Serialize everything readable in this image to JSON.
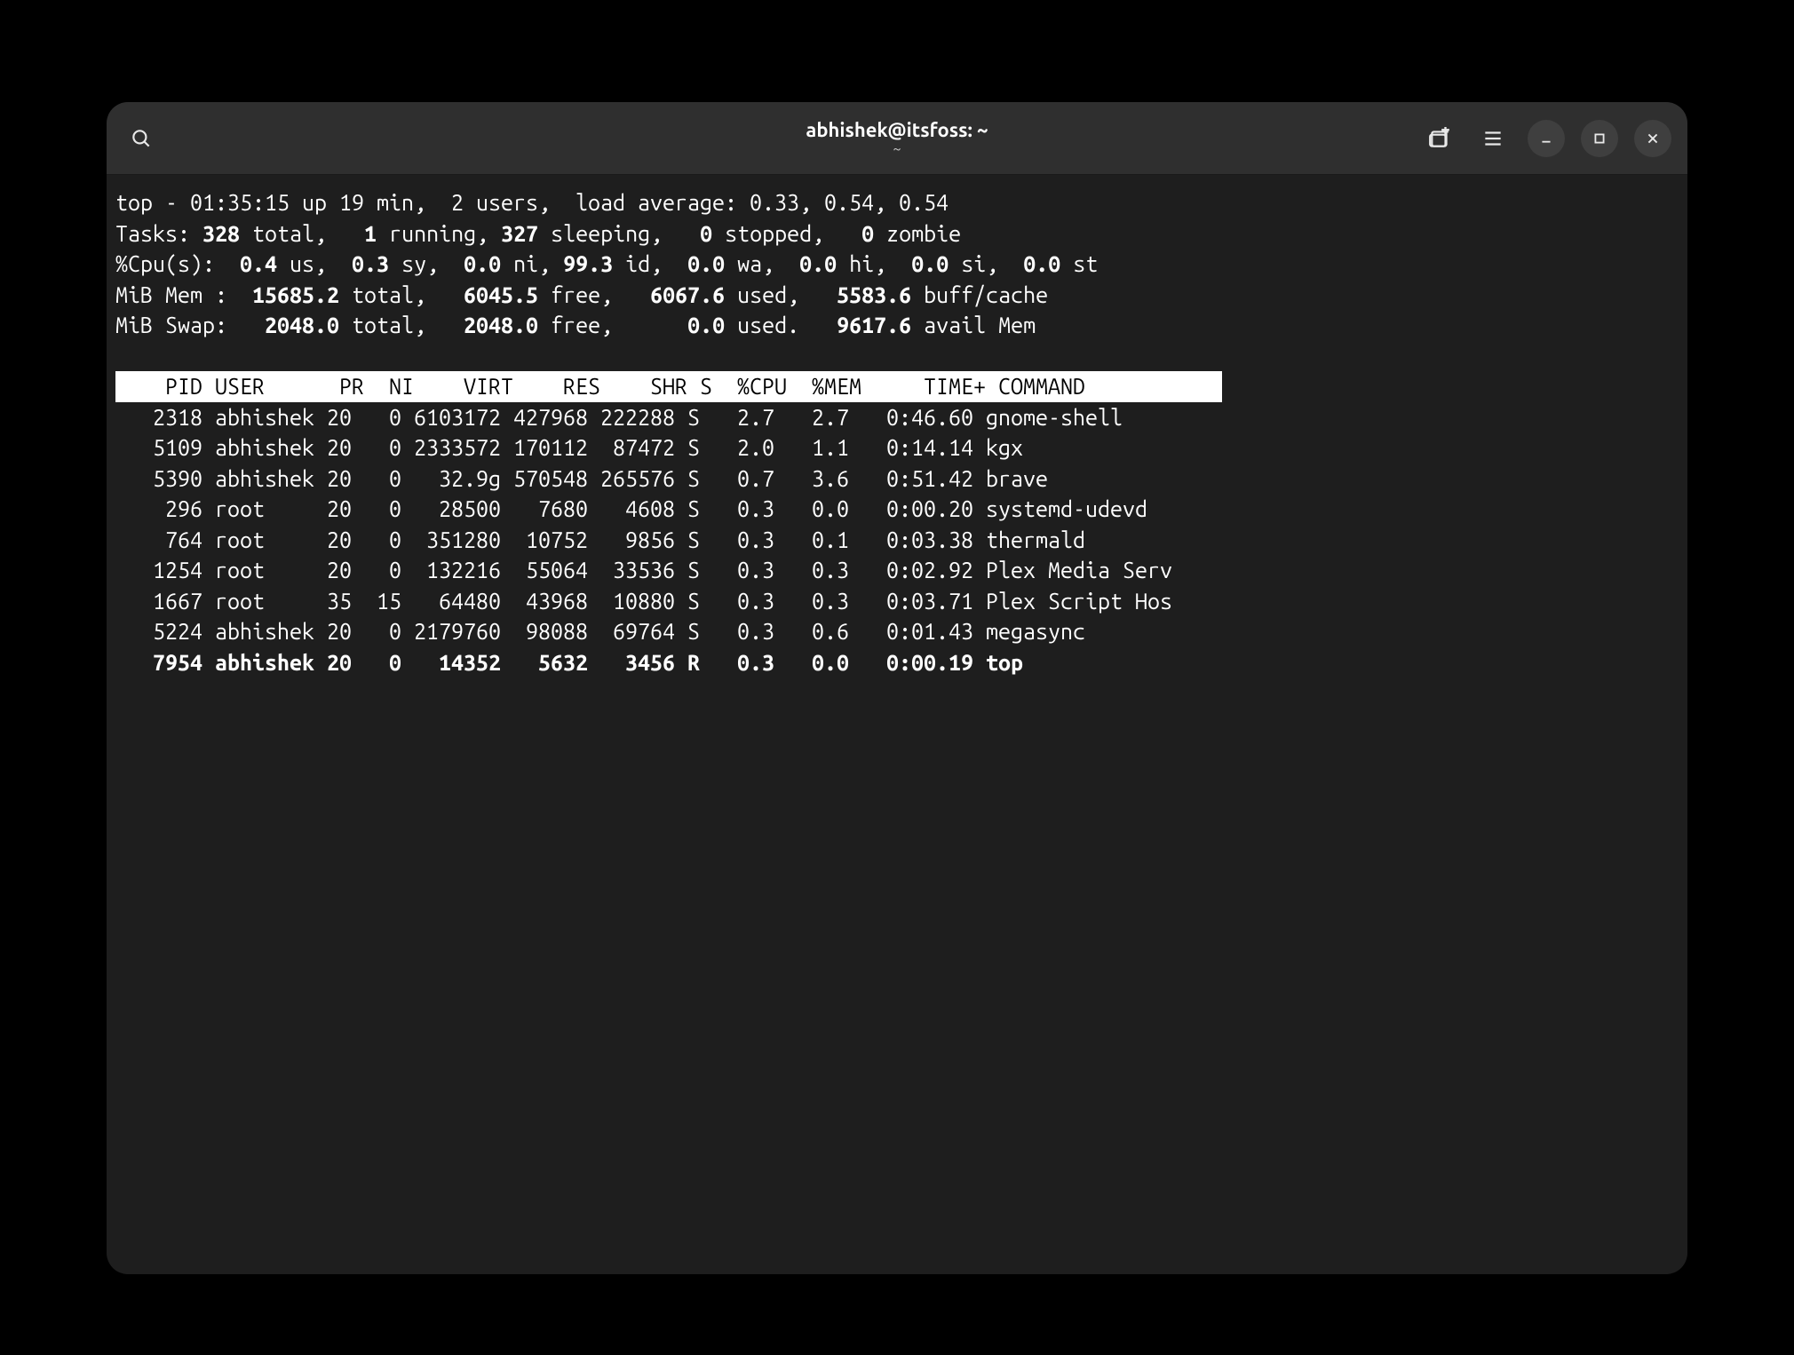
{
  "window": {
    "title": "abhishek@itsfoss: ~",
    "subtitle": "~"
  },
  "summary": {
    "line1_pre": "top - ",
    "time": "01:35:15",
    "uptime": " up 19 min,  ",
    "users": "2 users,",
    "load_label": "  load average: ",
    "load": "0.33, 0.54, 0.54",
    "tasks_label": "Tasks: ",
    "tasks_total": "328",
    "tasks_total_suf": " total,   ",
    "tasks_run": "1",
    "tasks_run_suf": " running, ",
    "tasks_sleep": "327",
    "tasks_sleep_suf": " sleeping,   ",
    "tasks_stop": "0",
    "tasks_stop_suf": " stopped,   ",
    "tasks_zomb": "0",
    "tasks_zomb_suf": " zombie",
    "cpu_label": "%Cpu(s):  ",
    "cpu_us": "0.4",
    "cpu_us_suf": " us,  ",
    "cpu_sy": "0.3",
    "cpu_sy_suf": " sy,  ",
    "cpu_ni": "0.0",
    "cpu_ni_suf": " ni, ",
    "cpu_id": "99.3",
    "cpu_id_suf": " id,  ",
    "cpu_wa": "0.0",
    "cpu_wa_suf": " wa,  ",
    "cpu_hi": "0.0",
    "cpu_hi_suf": " hi,  ",
    "cpu_si": "0.0",
    "cpu_si_suf": " si,  ",
    "cpu_st": "0.0",
    "cpu_st_suf": " st",
    "mem_label": "MiB Mem :  ",
    "mem_total": "15685.2",
    "mem_total_suf": " total,   ",
    "mem_free": "6045.5",
    "mem_free_suf": " free,   ",
    "mem_used": "6067.6",
    "mem_used_suf": " used,   ",
    "mem_buff": "5583.6",
    "mem_buff_suf": " buff/cache",
    "swap_label": "MiB Swap:   ",
    "swap_total": "2048.0",
    "swap_total_suf": " total,   ",
    "swap_free": "2048.0",
    "swap_free_suf": " free,      ",
    "swap_used": "0.0",
    "swap_used_suf": " used.   ",
    "swap_avail": "9617.6",
    "swap_avail_suf": " avail Mem"
  },
  "header": "    PID USER      PR  NI    VIRT    RES    SHR S  %CPU  %MEM     TIME+ COMMAND           ",
  "rows": [
    {
      "bold": false,
      "pid": "   2318",
      "user": "abhishek ",
      "pr": "20",
      "ni": "  0",
      "virt": "6103172",
      "res": "427968",
      "shr": "222288",
      "s": "S",
      "cpu": "  2.7",
      "mem": "  2.7",
      "time": "  0:46.60",
      "cmd": "gnome-shell"
    },
    {
      "bold": false,
      "pid": "   5109",
      "user": "abhishek ",
      "pr": "20",
      "ni": "  0",
      "virt": "2333572",
      "res": "170112",
      "shr": " 87472",
      "s": "S",
      "cpu": "  2.0",
      "mem": "  1.1",
      "time": "  0:14.14",
      "cmd": "kgx"
    },
    {
      "bold": false,
      "pid": "   5390",
      "user": "abhishek ",
      "pr": "20",
      "ni": "  0",
      "virt": "  32.9g",
      "res": "570548",
      "shr": "265576",
      "s": "S",
      "cpu": "  0.7",
      "mem": "  3.6",
      "time": "  0:51.42",
      "cmd": "brave"
    },
    {
      "bold": false,
      "pid": "    296",
      "user": "root     ",
      "pr": "20",
      "ni": "  0",
      "virt": "  28500",
      "res": "  7680",
      "shr": "  4608",
      "s": "S",
      "cpu": "  0.3",
      "mem": "  0.0",
      "time": "  0:00.20",
      "cmd": "systemd-udevd"
    },
    {
      "bold": false,
      "pid": "    764",
      "user": "root     ",
      "pr": "20",
      "ni": "  0",
      "virt": " 351280",
      "res": " 10752",
      "shr": "  9856",
      "s": "S",
      "cpu": "  0.3",
      "mem": "  0.1",
      "time": "  0:03.38",
      "cmd": "thermald"
    },
    {
      "bold": false,
      "pid": "   1254",
      "user": "root     ",
      "pr": "20",
      "ni": "  0",
      "virt": " 132216",
      "res": " 55064",
      "shr": " 33536",
      "s": "S",
      "cpu": "  0.3",
      "mem": "  0.3",
      "time": "  0:02.92",
      "cmd": "Plex Media Serv"
    },
    {
      "bold": false,
      "pid": "   1667",
      "user": "root     ",
      "pr": "35",
      "ni": " 15",
      "virt": "  64480",
      "res": " 43968",
      "shr": " 10880",
      "s": "S",
      "cpu": "  0.3",
      "mem": "  0.3",
      "time": "  0:03.71",
      "cmd": "Plex Script Hos"
    },
    {
      "bold": false,
      "pid": "   5224",
      "user": "abhishek ",
      "pr": "20",
      "ni": "  0",
      "virt": "2179760",
      "res": " 98088",
      "shr": " 69764",
      "s": "S",
      "cpu": "  0.3",
      "mem": "  0.6",
      "time": "  0:01.43",
      "cmd": "megasync"
    },
    {
      "bold": true,
      "pid": "   7954",
      "user": "abhishek ",
      "pr": "20",
      "ni": "  0",
      "virt": "  14352",
      "res": "  5632",
      "shr": "  3456",
      "s": "R",
      "cpu": "  0.3",
      "mem": "  0.0",
      "time": "  0:00.19",
      "cmd": "top"
    }
  ]
}
